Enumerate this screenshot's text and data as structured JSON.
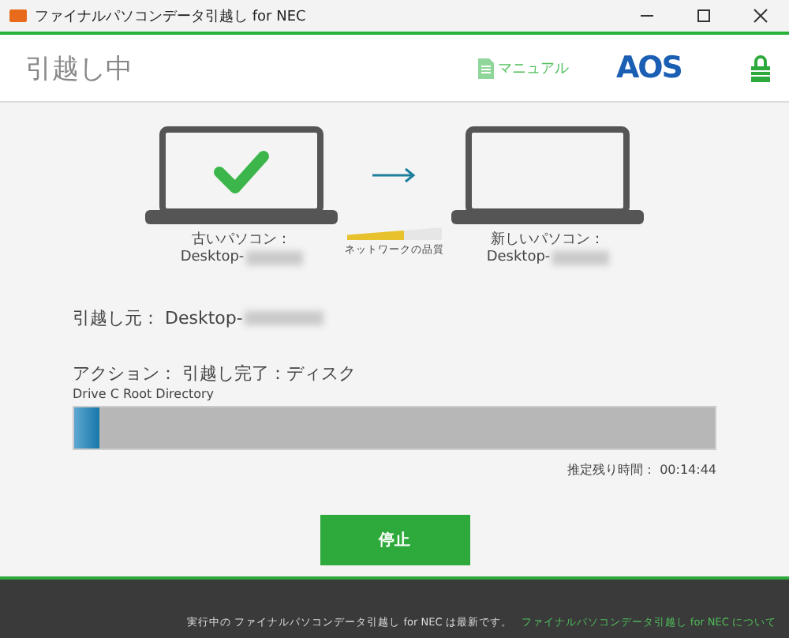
{
  "window": {
    "title": "ファイナルパソコンデータ引越し for NEC"
  },
  "header": {
    "title": "引越し中",
    "manual_link": "マニュアル",
    "logo": "AOS"
  },
  "old_pc": {
    "label": "古いパソコン：",
    "name": "Desktop-",
    "done": true
  },
  "new_pc": {
    "label": "新しいパソコン：",
    "name": "Desktop-",
    "done": false
  },
  "network": {
    "label": "ネットワークの品質",
    "level": 0.6
  },
  "source": {
    "label": "引越し元：",
    "value": "Desktop-"
  },
  "action": {
    "label": "アクション：",
    "value": "引越し完了：ディスク",
    "detail": "Drive C Root Directory"
  },
  "progress": {
    "level": 0.04
  },
  "remaining": {
    "label": "推定残り時間：",
    "value": "00:14:44"
  },
  "stop_button": "停止",
  "footer": {
    "message": "実行中の ファイナルパソコンデータ引越し for NEC は最新です。",
    "link": "ファイナルパソコンデータ引越し for NEC について"
  }
}
